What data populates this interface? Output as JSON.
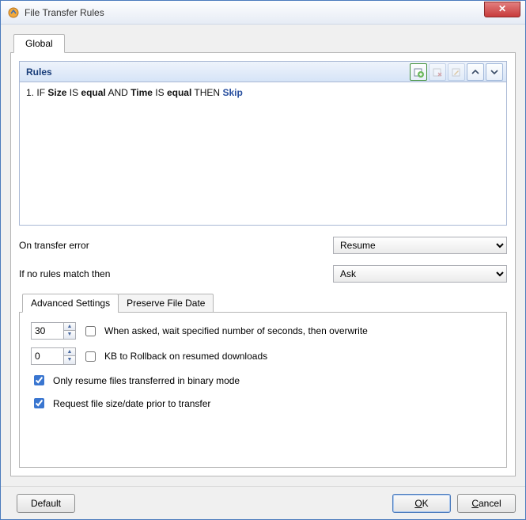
{
  "window": {
    "title": "File Transfer Rules"
  },
  "tabs": {
    "main": "Global"
  },
  "rules": {
    "header": "Rules",
    "items": [
      {
        "num": "1.",
        "text_parts": [
          "IF",
          "Size",
          "IS",
          "equal",
          "AND",
          "Time",
          "IS",
          "equal",
          "THEN",
          "Skip"
        ]
      }
    ]
  },
  "toolbar_icons": {
    "add": "add-rule-icon",
    "delete": "delete-rule-icon",
    "edit": "edit-rule-icon",
    "up": "move-up-icon",
    "down": "move-down-icon"
  },
  "options": {
    "on_error_label": "On transfer error",
    "on_error_value": "Resume",
    "no_match_label": "If no rules match then",
    "no_match_value": "Ask"
  },
  "inner_tabs": {
    "advanced": "Advanced Settings",
    "preserve": "Preserve File Date"
  },
  "advanced": {
    "wait_seconds": "30",
    "wait_label": "When asked, wait specified number of seconds, then overwrite",
    "wait_checked": false,
    "rollback_kb": "0",
    "rollback_label": "KB to Rollback on resumed downloads",
    "rollback_checked": false,
    "resume_binary_label": "Only resume files transferred in binary mode",
    "resume_binary_checked": true,
    "request_size_label": "Request file size/date prior to transfer",
    "request_size_checked": true
  },
  "buttons": {
    "default": "Default",
    "ok": "OK",
    "cancel": "Cancel"
  }
}
